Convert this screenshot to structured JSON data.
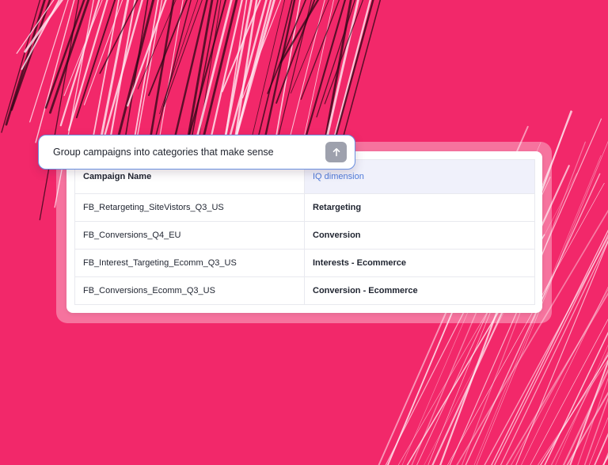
{
  "prompt": {
    "text": "Group campaigns into categories that make sense",
    "send_icon": "arrow-up-icon"
  },
  "table": {
    "headers": [
      "Campaign Name",
      "IQ dimension"
    ],
    "rows": [
      {
        "campaign": "FB_Retargeting_SiteVistors_Q3_US",
        "dimension": "Retargeting"
      },
      {
        "campaign": "FB_Conversions_Q4_EU",
        "dimension": "Conversion"
      },
      {
        "campaign": "FB_Interest_Targeting_Ecomm_Q3_US",
        "dimension": "Interests - Ecommerce"
      },
      {
        "campaign": "FB_Conversions_Ecomm_Q3_US",
        "dimension": "Conversion - Ecommerce"
      }
    ]
  },
  "colors": {
    "background": "#f2286a",
    "header_highlight": "#f0f1fb",
    "header_accent_text": "#4e7ad9",
    "prompt_border": "#6a8fe0",
    "send_button": "#9ea1ad"
  }
}
